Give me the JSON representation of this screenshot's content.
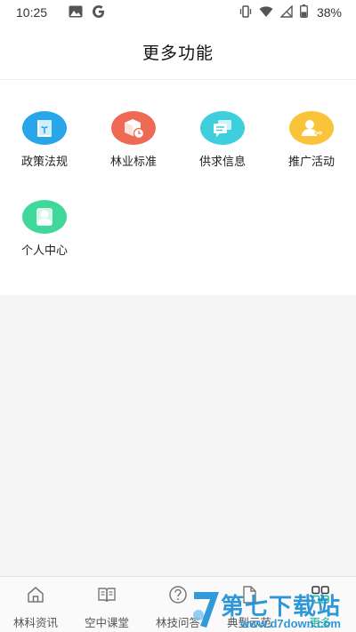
{
  "status_bar": {
    "time": "10:25",
    "battery": "38%",
    "left_icons": [
      "image-icon",
      "google-icon"
    ],
    "right_icons": [
      "vibrate-icon",
      "wifi-icon",
      "signal-icon",
      "battery-icon"
    ]
  },
  "header": {
    "title": "更多功能"
  },
  "grid": {
    "items": [
      {
        "label": "政策法规",
        "icon": "policy-book-icon",
        "color": "#29a6ea"
      },
      {
        "label": "林业标准",
        "icon": "box-clock-icon",
        "color": "#ef6a55"
      },
      {
        "label": "供求信息",
        "icon": "chat-bubbles-icon",
        "color": "#3fcfdc"
      },
      {
        "label": "推广活动",
        "icon": "user-share-icon",
        "color": "#f9c43a"
      },
      {
        "label": "个人中心",
        "icon": "person-icon",
        "color": "#3fd89a"
      }
    ]
  },
  "bottom_nav": {
    "items": [
      {
        "label": "林科资讯",
        "icon": "home-icon",
        "active": false
      },
      {
        "label": "空中课堂",
        "icon": "open-book-icon",
        "active": false
      },
      {
        "label": "林技问答",
        "icon": "question-icon",
        "active": false
      },
      {
        "label": "典型示范",
        "icon": "document-icon",
        "active": false
      },
      {
        "label": "更多",
        "icon": "grid-icon",
        "active": true
      }
    ],
    "active_color": "#1fb89a"
  },
  "watermark": {
    "title": "第七下载站",
    "subtitle": "www.d7down.com"
  }
}
